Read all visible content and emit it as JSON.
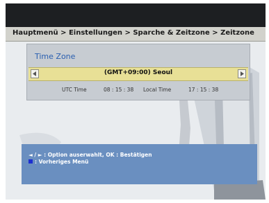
{
  "breadcrumb": "Hauptmenü > Einstellungen > Sparche & Zeitzone > Zeitzone",
  "panel": {
    "title": "Time Zone",
    "selected_value": "(GMT+09:00) Seoul"
  },
  "time": {
    "utc_label": "UTC Time",
    "utc_value": "08 : 15 : 38",
    "local_label": "Local Time",
    "local_value": "17 : 15 : 38"
  },
  "help": {
    "line1": "◄ / ► : Option auserwahlt, OK : Bestätigen",
    "line2": ": Vorheriges Menü"
  },
  "icons": {
    "left": "arrow-left-icon",
    "right": "arrow-right-icon",
    "blue_key": "blue-square-icon"
  },
  "colors": {
    "title_blue": "#2a5fb0",
    "selector_yellow": "#e8e096",
    "help_blue": "#6a8fc0",
    "blue_key": "#1c2fd0"
  }
}
